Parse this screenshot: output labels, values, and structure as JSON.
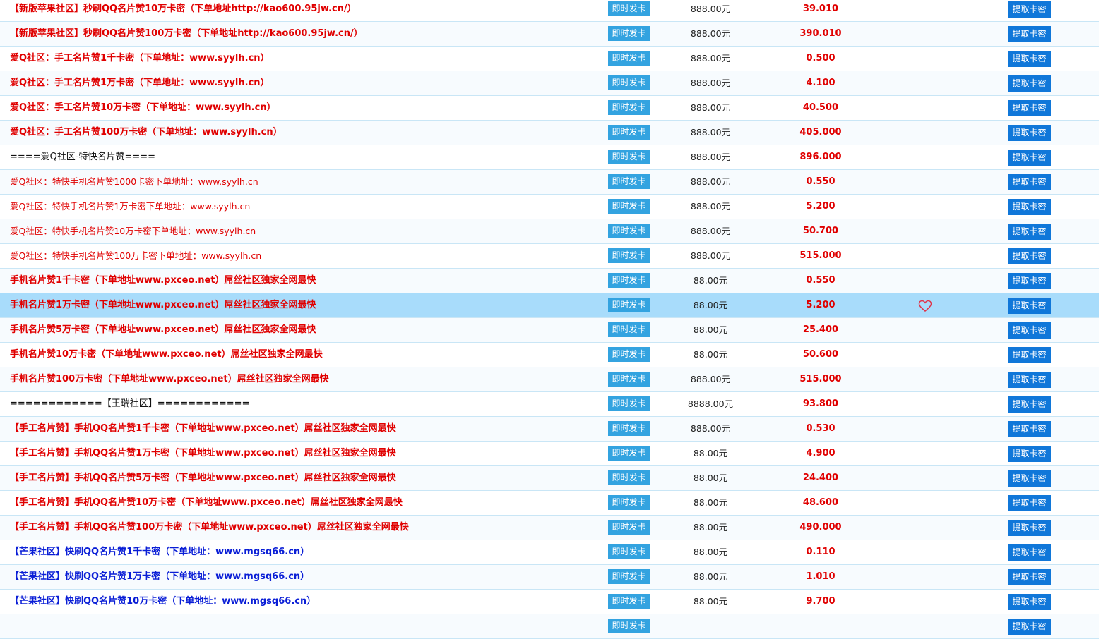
{
  "buttons": {
    "issue_label": "即时发卡",
    "fetch_label": "提取卡密"
  },
  "rows": [
    {
      "name": "【新版苹果社区】秒刷QQ名片赞10万卡密（下单地址http://kao600.95jw.cn/）",
      "style": "red",
      "price": "888.00元",
      "rate": "39.010"
    },
    {
      "name": "【新版苹果社区】秒刷QQ名片赞100万卡密（下单地址http://kao600.95jw.cn/）",
      "style": "red",
      "price": "888.00元",
      "rate": "390.010"
    },
    {
      "name": "爱Q社区：手工名片赞1千卡密（下单地址：www.syylh.cn）",
      "style": "red",
      "price": "888.00元",
      "rate": "0.500"
    },
    {
      "name": "爱Q社区：手工名片赞1万卡密（下单地址：www.syylh.cn）",
      "style": "red",
      "price": "888.00元",
      "rate": "4.100"
    },
    {
      "name": "爱Q社区：手工名片赞10万卡密（下单地址：www.syylh.cn）",
      "style": "red",
      "price": "888.00元",
      "rate": "40.500"
    },
    {
      "name": "爱Q社区：手工名片赞100万卡密（下单地址：www.syylh.cn）",
      "style": "red",
      "price": "888.00元",
      "rate": "405.000"
    },
    {
      "name": "====爱Q社区-特快名片赞====",
      "style": "black",
      "price": "888.00元",
      "rate": "896.000"
    },
    {
      "name": "爱Q社区：特快手机名片赞1000卡密下单地址：www.syylh.cn",
      "style": "red thin",
      "price": "888.00元",
      "rate": "0.550"
    },
    {
      "name": "爱Q社区：特快手机名片赞1万卡密下单地址：www.syylh.cn",
      "style": "red thin",
      "price": "888.00元",
      "rate": "5.200"
    },
    {
      "name": "爱Q社区：特快手机名片赞10万卡密下单地址：www.syylh.cn",
      "style": "red thin",
      "price": "888.00元",
      "rate": "50.700"
    },
    {
      "name": "爱Q社区：特快手机名片赞100万卡密下单地址：www.syylh.cn",
      "style": "red thin",
      "price": "888.00元",
      "rate": "515.000"
    },
    {
      "name": "手机名片赞1千卡密（下单地址www.pxceo.net）屌丝社区独家全网最快",
      "style": "red",
      "price": "88.00元",
      "rate": "0.550"
    },
    {
      "name": "手机名片赞1万卡密（下单地址www.pxceo.net）屌丝社区独家全网最快",
      "style": "red",
      "price": "88.00元",
      "rate": "5.200",
      "highlight": true
    },
    {
      "name": "手机名片赞5万卡密（下单地址www.pxceo.net）屌丝社区独家全网最快",
      "style": "red",
      "price": "88.00元",
      "rate": "25.400"
    },
    {
      "name": "手机名片赞10万卡密（下单地址www.pxceo.net）屌丝社区独家全网最快",
      "style": "red",
      "price": "88.00元",
      "rate": "50.600"
    },
    {
      "name": "手机名片赞100万卡密（下单地址www.pxceo.net）屌丝社区独家全网最快",
      "style": "red",
      "price": "888.00元",
      "rate": "515.000"
    },
    {
      "name": "============【王瑞社区】============",
      "style": "black",
      "price": "8888.00元",
      "rate": "93.800"
    },
    {
      "name": "【手工名片赞】手机QQ名片赞1千卡密（下单地址www.pxceo.net）屌丝社区独家全网最快",
      "style": "red",
      "price": "888.00元",
      "rate": "0.530"
    },
    {
      "name": "【手工名片赞】手机QQ名片赞1万卡密（下单地址www.pxceo.net）屌丝社区独家全网最快",
      "style": "red",
      "price": "88.00元",
      "rate": "4.900"
    },
    {
      "name": "【手工名片赞】手机QQ名片赞5万卡密（下单地址www.pxceo.net）屌丝社区独家全网最快",
      "style": "red",
      "price": "88.00元",
      "rate": "24.400"
    },
    {
      "name": "【手工名片赞】手机QQ名片赞10万卡密（下单地址www.pxceo.net）屌丝社区独家全网最快",
      "style": "red",
      "price": "88.00元",
      "rate": "48.600"
    },
    {
      "name": "【手工名片赞】手机QQ名片赞100万卡密（下单地址www.pxceo.net）屌丝社区独家全网最快",
      "style": "red",
      "price": "88.00元",
      "rate": "490.000"
    },
    {
      "name": "【芒果社区】快刷QQ名片赞1千卡密（下单地址：www.mgsq66.cn）",
      "style": "blue",
      "price": "88.00元",
      "rate": "0.110"
    },
    {
      "name": "【芒果社区】快刷QQ名片赞1万卡密（下单地址：www.mgsq66.cn）",
      "style": "blue",
      "price": "88.00元",
      "rate": "1.010"
    },
    {
      "name": "【芒果社区】快刷QQ名片赞10万卡密（下单地址：www.mgsq66.cn）",
      "style": "blue",
      "price": "88.00元",
      "rate": "9.700"
    },
    {
      "name": "",
      "style": "red",
      "price": "",
      "rate": ""
    }
  ],
  "colors": {
    "issue_button": "#33a3e0",
    "fetch_button": "#1077d9",
    "price_red": "#e00000",
    "highlight_row": "#a8dcfb",
    "row_border": "#c9e6f6"
  },
  "icons": {
    "favorite": "heart-outline-icon"
  }
}
